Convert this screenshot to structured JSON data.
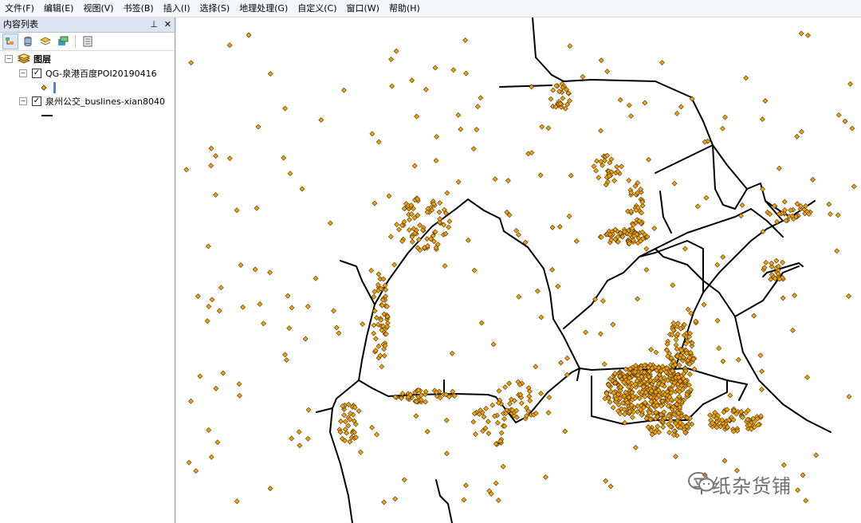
{
  "menubar": [
    {
      "label": "文件(F)"
    },
    {
      "label": "编辑(E)"
    },
    {
      "label": "视图(V)"
    },
    {
      "label": "书签(B)"
    },
    {
      "label": "插入(I)"
    },
    {
      "label": "选择(S)"
    },
    {
      "label": "地理处理(G)"
    },
    {
      "label": "自定义(C)"
    },
    {
      "label": "窗口(W)"
    },
    {
      "label": "帮助(H)"
    }
  ],
  "toc": {
    "title": "内容列表",
    "pin_glyph": "⊥",
    "close_glyph": "✕",
    "root_label": "图层",
    "layers": [
      {
        "name": "QG-泉港百度POI20190416",
        "checked": true,
        "symbol": "point",
        "symbol_color": "#f2a20c"
      },
      {
        "name": "泉州公交_buslines-xian8040",
        "checked": true,
        "symbol": "line",
        "symbol_color": "#000000"
      }
    ]
  },
  "icons": {
    "pin": "pin-icon",
    "close": "close-icon",
    "list_by_drawing_order": "drawing-order-icon",
    "list_by_source": "source-icon",
    "list_by_visibility": "visibility-icon",
    "list_by_selection": "selection-icon",
    "options": "options-icon",
    "layers": "layers-icon",
    "wechat": "wechat-icon"
  },
  "colors": {
    "poi_fill": "#f2a20c",
    "poi_stroke": "#4a3200",
    "busline": "#000000",
    "map_bg": "#ffffff"
  },
  "watermark": {
    "text": "平纸杂货铺"
  }
}
